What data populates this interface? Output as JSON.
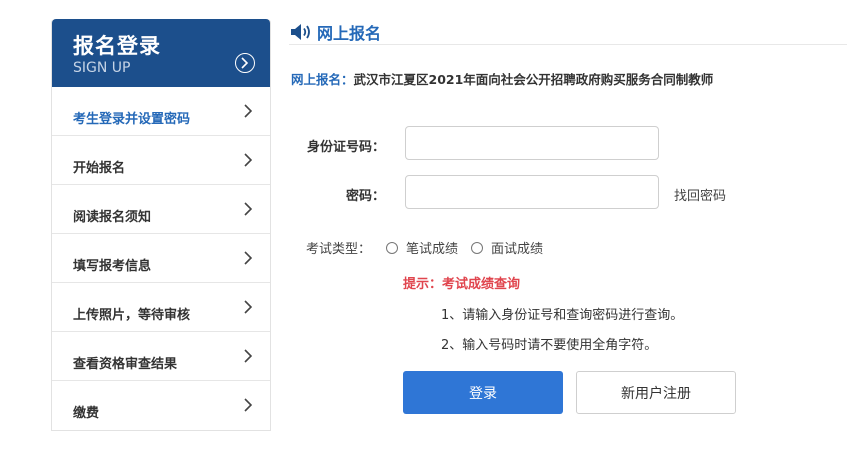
{
  "sidebar": {
    "title": "报名登录",
    "subtitle": "SIGN UP",
    "items": [
      {
        "label": "考生登录并设置密码"
      },
      {
        "label": "开始报名"
      },
      {
        "label": "阅读报名须知"
      },
      {
        "label": "填写报考信息"
      },
      {
        "label": "上传照片，等待审核"
      },
      {
        "label": "查看资格审查结果"
      },
      {
        "label": "缴费"
      }
    ]
  },
  "main": {
    "section_title": "网上报名",
    "notice_prefix": "网上报名：",
    "notice_text": "武汉市江夏区2021年面向社会公开招聘政府购买服务合同制教师",
    "id_label": "身份证号码：",
    "id_value": "",
    "password_label": "密码：",
    "password_value": "",
    "forgot_link": "找回密码",
    "exam_type_label": "考试类型：",
    "exam_types": [
      "笔试成绩",
      "面试成绩"
    ],
    "tip": "提示：考试成绩查询",
    "notes": [
      "1、请输入身份证号和查询密码进行查询。",
      "2、输入号码时请不要使用全角字符。"
    ],
    "login_button": "登录",
    "register_button": "新用户注册"
  },
  "colors": {
    "brand": "#1c4f8c",
    "accent": "#2569b8",
    "button": "#2f76d6",
    "warning": "#e0454e"
  },
  "icons": {
    "speaker": "speaker-icon",
    "chevron": "chevron-right-icon",
    "circle_chevron": "circle-chevron-right-icon"
  }
}
